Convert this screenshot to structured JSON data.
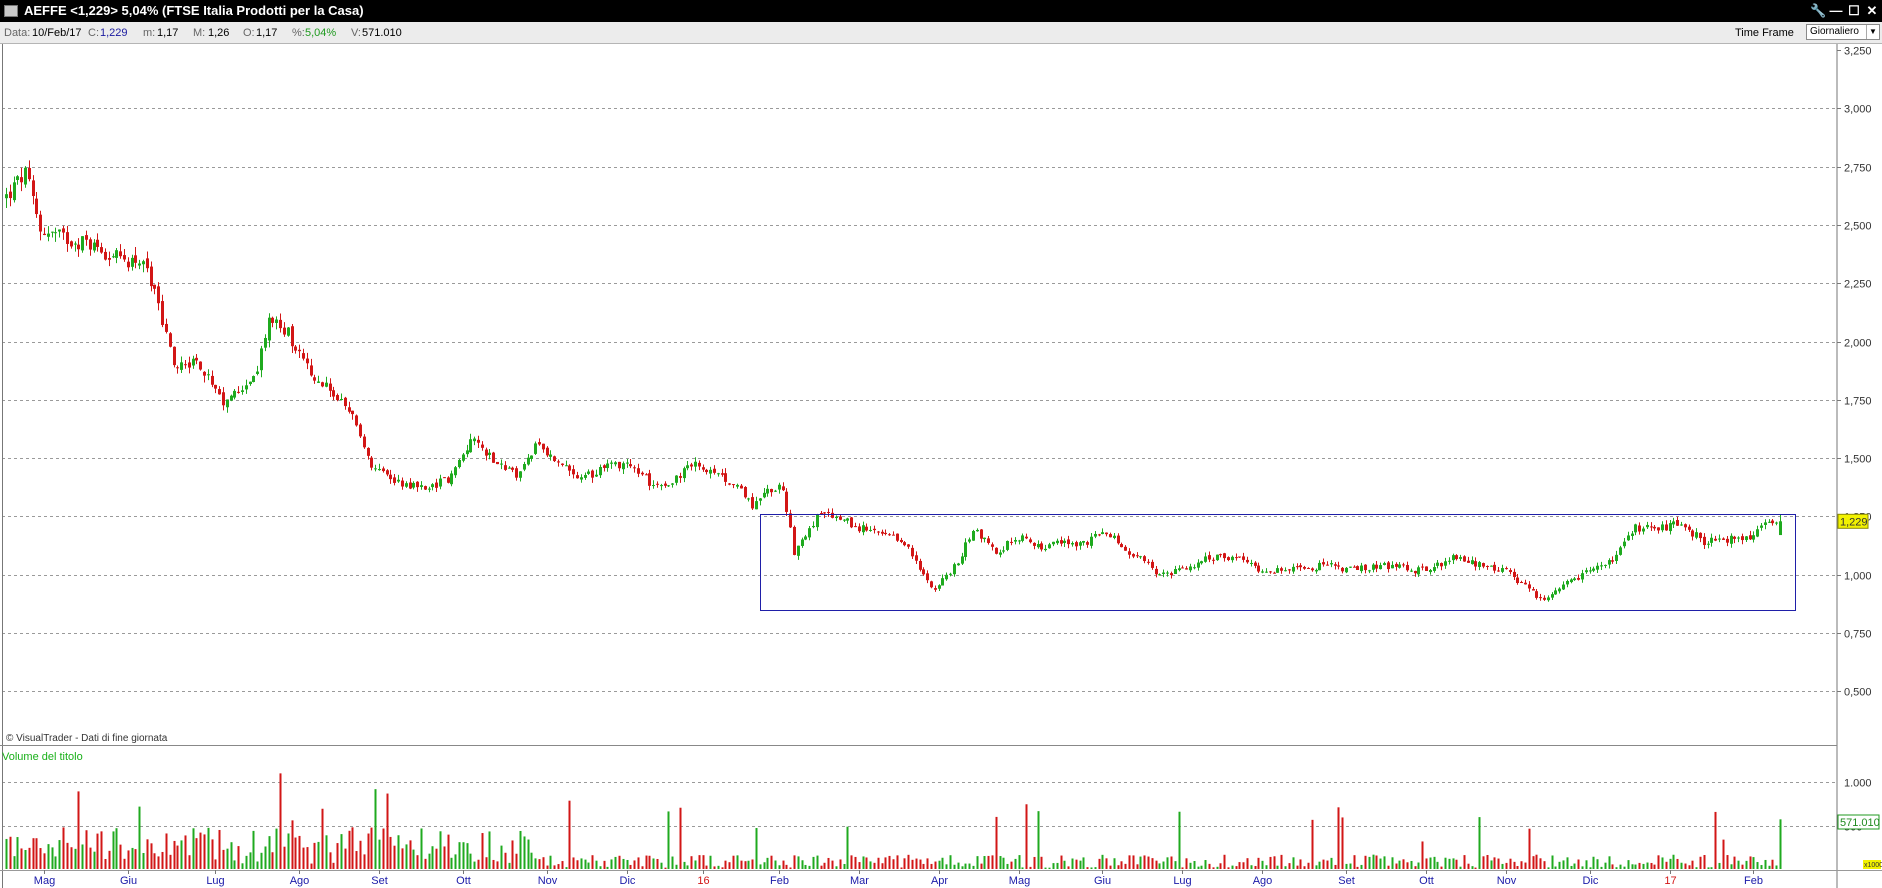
{
  "window": {
    "title": "AEFFE <1,229> 5,04%  (FTSE Italia Prodotti per la Casa)",
    "buttons": [
      "🔧",
      "—",
      "☐",
      "✕"
    ]
  },
  "infobar": {
    "data_label": "Data:",
    "data_value": "10/Feb/17",
    "c_label": "C:",
    "c_value": "1,229",
    "m_label": "m:",
    "m_value": "1,17",
    "M_label": "M:",
    "M_value": "1,26",
    "o_label": "O:",
    "o_value": "1,17",
    "pct_label": "%:",
    "pct_value": "5,04%",
    "v_label": "V:",
    "v_value": "571.010",
    "timeframe_label": "Time Frame",
    "timeframe_value": "Giornaliero"
  },
  "copyright": "© VisualTrader - Dati di fine giornata",
  "volume_title": "Volume del titolo",
  "colors": {
    "up": "#1faa1f",
    "down": "#d21616",
    "box": "#1f1fa8",
    "grid": "#9a9a9a",
    "last_price_bg": "#f2f200",
    "volume_label_border": "#1f9a1f"
  },
  "chart_data": {
    "type": "candlestick",
    "price_axis": {
      "ylim": [
        0.25,
        3.25
      ],
      "ticks": [
        "3,250",
        "3,000",
        "2,750",
        "2,500",
        "2,250",
        "2,000",
        "1,750",
        "1,500",
        "1,250",
        "1,000",
        "0,750",
        "0,500"
      ],
      "tick_values": [
        3.25,
        3.0,
        2.75,
        2.5,
        2.25,
        2.0,
        1.75,
        1.5,
        1.25,
        1.0,
        0.75,
        0.5
      ],
      "grid": true,
      "last_price_label": "1,229",
      "last_price": 1.229
    },
    "volume_axis": {
      "ticks": [
        "1.000",
        "500"
      ],
      "tick_values": [
        1000,
        500
      ],
      "ymax": 1350,
      "last_volume_label": "571.010",
      "last_volume": 571,
      "unit_label": "x1000"
    },
    "x_axis": {
      "labels": [
        {
          "text": "Mag",
          "day": 10,
          "color": "blue"
        },
        {
          "text": "Giu",
          "day": 32,
          "color": "blue"
        },
        {
          "text": "Lug",
          "day": 55,
          "color": "blue"
        },
        {
          "text": "Ago",
          "day": 77,
          "color": "blue"
        },
        {
          "text": "Set",
          "day": 98,
          "color": "blue"
        },
        {
          "text": "Ott",
          "day": 120,
          "color": "blue"
        },
        {
          "text": "Nov",
          "day": 142,
          "color": "blue"
        },
        {
          "text": "Dic",
          "day": 163,
          "color": "blue"
        },
        {
          "text": "16",
          "day": 183,
          "color": "red"
        },
        {
          "text": "Feb",
          "day": 203,
          "color": "blue"
        },
        {
          "text": "Mar",
          "day": 224,
          "color": "blue"
        },
        {
          "text": "Apr",
          "day": 245,
          "color": "blue"
        },
        {
          "text": "Mag",
          "day": 266,
          "color": "blue"
        },
        {
          "text": "Giu",
          "day": 288,
          "color": "blue"
        },
        {
          "text": "Lug",
          "day": 309,
          "color": "blue"
        },
        {
          "text": "Ago",
          "day": 330,
          "color": "blue"
        },
        {
          "text": "Set",
          "day": 352,
          "color": "blue"
        },
        {
          "text": "Ott",
          "day": 373,
          "color": "blue"
        },
        {
          "text": "Nov",
          "day": 394,
          "color": "blue"
        },
        {
          "text": "Dic",
          "day": 416,
          "color": "blue"
        },
        {
          "text": "17",
          "day": 437,
          "color": "red"
        },
        {
          "text": "Feb",
          "day": 459,
          "color": "blue"
        }
      ]
    },
    "days": 466,
    "anchors": [
      [
        0,
        2.62
      ],
      [
        5,
        2.72
      ],
      [
        9,
        2.48
      ],
      [
        16,
        2.44
      ],
      [
        22,
        2.42
      ],
      [
        30,
        2.35
      ],
      [
        36,
        2.35
      ],
      [
        40,
        2.15
      ],
      [
        44,
        1.9
      ],
      [
        50,
        1.92
      ],
      [
        57,
        1.72
      ],
      [
        61,
        1.8
      ],
      [
        66,
        1.87
      ],
      [
        69,
        2.1
      ],
      [
        74,
        2.04
      ],
      [
        80,
        1.85
      ],
      [
        86,
        1.78
      ],
      [
        92,
        1.65
      ],
      [
        96,
        1.45
      ],
      [
        103,
        1.4
      ],
      [
        110,
        1.37
      ],
      [
        117,
        1.42
      ],
      [
        122,
        1.58
      ],
      [
        128,
        1.5
      ],
      [
        134,
        1.42
      ],
      [
        139,
        1.55
      ],
      [
        145,
        1.48
      ],
      [
        151,
        1.4
      ],
      [
        157,
        1.47
      ],
      [
        163,
        1.48
      ],
      [
        169,
        1.4
      ],
      [
        175,
        1.4
      ],
      [
        181,
        1.48
      ],
      [
        186,
        1.42
      ],
      [
        191,
        1.4
      ],
      [
        196,
        1.3
      ],
      [
        200,
        1.36
      ],
      [
        204,
        1.38
      ],
      [
        207,
        1.1
      ],
      [
        213,
        1.25
      ],
      [
        218,
        1.25
      ],
      [
        224,
        1.2
      ],
      [
        230,
        1.17
      ],
      [
        236,
        1.14
      ],
      [
        240,
        1.02
      ],
      [
        244,
        0.94
      ],
      [
        250,
        1.05
      ],
      [
        254,
        1.2
      ],
      [
        260,
        1.1
      ],
      [
        266,
        1.16
      ],
      [
        272,
        1.12
      ],
      [
        278,
        1.14
      ],
      [
        283,
        1.13
      ],
      [
        289,
        1.19
      ],
      [
        294,
        1.1
      ],
      [
        299,
        1.06
      ],
      [
        303,
        1.0
      ],
      [
        309,
        1.02
      ],
      [
        314,
        1.06
      ],
      [
        320,
        1.08
      ],
      [
        325,
        1.06
      ],
      [
        330,
        1.02
      ],
      [
        338,
        1.02
      ],
      [
        346,
        1.04
      ],
      [
        354,
        1.02
      ],
      [
        362,
        1.04
      ],
      [
        370,
        1.02
      ],
      [
        375,
        1.03
      ],
      [
        380,
        1.07
      ],
      [
        388,
        1.04
      ],
      [
        394,
        1.01
      ],
      [
        401,
        0.92
      ],
      [
        404,
        0.88
      ],
      [
        410,
        0.96
      ],
      [
        416,
        1.02
      ],
      [
        422,
        1.06
      ],
      [
        428,
        1.2
      ],
      [
        434,
        1.2
      ],
      [
        440,
        1.22
      ],
      [
        446,
        1.14
      ],
      [
        452,
        1.15
      ],
      [
        458,
        1.16
      ],
      [
        462,
        1.22
      ],
      [
        466,
        1.229
      ]
    ],
    "range_box": {
      "x_start_day": 198,
      "x_end_day": 466,
      "y_low": 0.85,
      "y_high": 1.26
    }
  }
}
